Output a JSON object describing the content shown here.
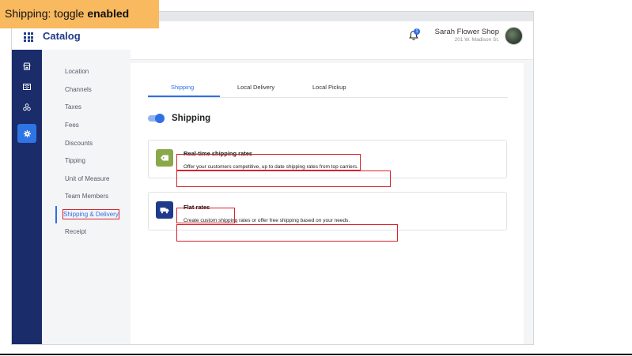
{
  "caption": {
    "prefix": "Shipping: toggle ",
    "state": "enabled",
    "bg": "#f9b95f"
  },
  "header": {
    "app_title": "Catalog",
    "notification_count": "1",
    "shop_name": "Sarah Flower Shop",
    "shop_address": "201 W. Madison St."
  },
  "rail": {
    "icons": [
      "storefront-icon",
      "book-icon",
      "people-icon",
      "gear-icon"
    ],
    "active": "gear-icon"
  },
  "subnav": {
    "items": [
      "Location",
      "Channels",
      "Taxes",
      "Fees",
      "Discounts",
      "Tipping",
      "Unit of Measure",
      "Team Members",
      "Shipping & Delivery",
      "Receipt"
    ],
    "active": "Shipping & Delivery"
  },
  "tabs": {
    "items": [
      "Shipping",
      "Local Delivery",
      "Local Pickup"
    ],
    "active": "Shipping"
  },
  "shipping": {
    "title": "Shipping",
    "toggle_enabled": true,
    "cards": [
      {
        "title": "Real-time shipping rates",
        "description": "Offer your customers competitive, up to date shipping rates from top carriers.",
        "icon": "tag-icon",
        "icon_color": "#8aa84a"
      },
      {
        "title": "Flat rates",
        "description": "Create custom shipping rates or offer free shipping based on your needs.",
        "icon": "truck-icon",
        "icon_color": "#1f3a8a"
      }
    ]
  },
  "colors": {
    "accent": "#2f6fe4",
    "rail": "#1b2c6b",
    "highlight": "#d9232e"
  }
}
